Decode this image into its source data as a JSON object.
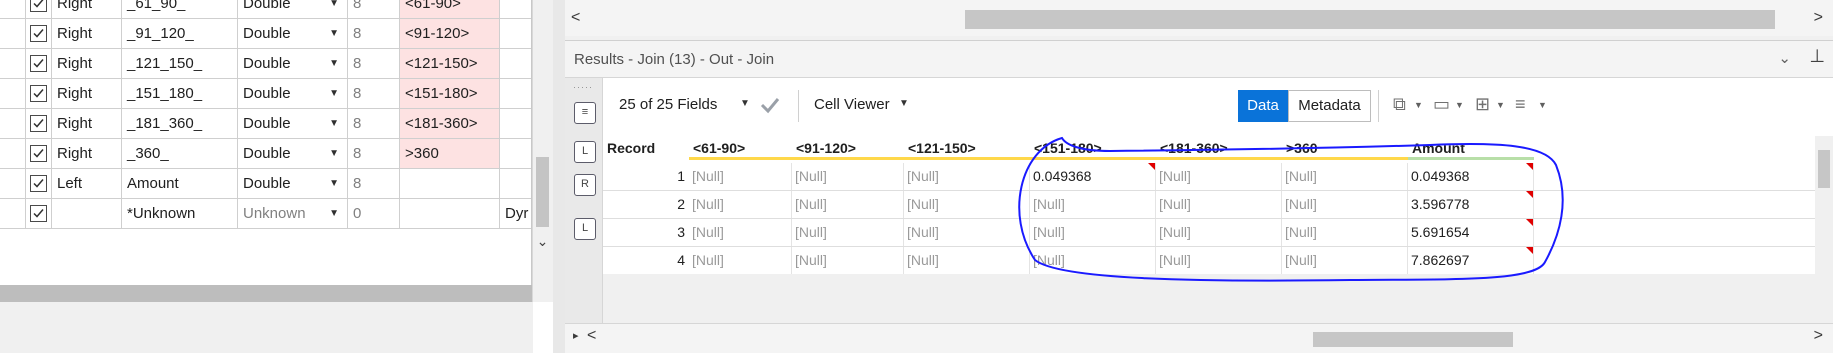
{
  "config_grid": {
    "partial_top_row": {
      "input": "Right",
      "field": "_61_90_",
      "type": "Double",
      "size": "8",
      "rename": "<61-90>"
    },
    "rows": [
      {
        "checked": true,
        "input": "Right",
        "field": "_91_120_",
        "type": "Double",
        "size": "8",
        "rename": "<91-120>"
      },
      {
        "checked": true,
        "input": "Right",
        "field": "_121_150_",
        "type": "Double",
        "size": "8",
        "rename": "<121-150>"
      },
      {
        "checked": true,
        "input": "Right",
        "field": "_151_180_",
        "type": "Double",
        "size": "8",
        "rename": "<151-180>"
      },
      {
        "checked": true,
        "input": "Right",
        "field": "_181_360_",
        "type": "Double",
        "size": "8",
        "rename": "<181-360>"
      },
      {
        "checked": true,
        "input": "Right",
        "field": "_360_",
        "type": "Double",
        "size": "8",
        "rename": ">360"
      },
      {
        "checked": true,
        "input": "Left",
        "field": "Amount",
        "type": "Double",
        "size": "8",
        "rename": ""
      },
      {
        "checked": true,
        "input": "",
        "field": "*Unknown",
        "type": "Unknown",
        "size": "0",
        "rename": "",
        "description": "Dyr"
      }
    ]
  },
  "results": {
    "title": "Results - Join (13) - Out - Join",
    "fields_count_label": "25 of 25 Fields",
    "cell_viewer_label": "Cell Viewer",
    "data_button": "Data",
    "metadata_button": "Metadata",
    "side_buttons": [
      "L",
      "R",
      "L"
    ],
    "columns": [
      "Record",
      "<61-90>",
      "<91-120>",
      "<121-150>",
      "<151-180>",
      "<181-360>",
      ">360",
      "Amount"
    ],
    "rows": [
      {
        "record": "1",
        "values": [
          "[Null]",
          "[Null]",
          "[Null]",
          "0.049368",
          "[Null]",
          "[Null]",
          "0.049368"
        ]
      },
      {
        "record": "2",
        "values": [
          "[Null]",
          "[Null]",
          "[Null]",
          "[Null]",
          "[Null]",
          "[Null]",
          "3.596778"
        ]
      },
      {
        "record": "3",
        "values": [
          "[Null]",
          "[Null]",
          "[Null]",
          "[Null]",
          "[Null]",
          "[Null]",
          "5.691654"
        ]
      },
      {
        "record": "4",
        "values": [
          "[Null]",
          "[Null]",
          "[Null]",
          "[Null]",
          "[Null]",
          "[Null]",
          "7.862697"
        ]
      }
    ]
  },
  "icons": [
    "checkbox-checked-icon",
    "dropdown-arrow-icon",
    "checkmark-icon",
    "copy-icon",
    "save-icon",
    "add-column-icon",
    "menu-icon",
    "chevron-down-icon",
    "pin-icon",
    "scroll-left-icon",
    "scroll-right-icon"
  ],
  "colors": {
    "accent": "#0a73d9",
    "rename_highlight": "#fde2e2",
    "annotation": "#1a1aff",
    "null_text": "#9a9a9a",
    "flag_red": "#e00000"
  }
}
